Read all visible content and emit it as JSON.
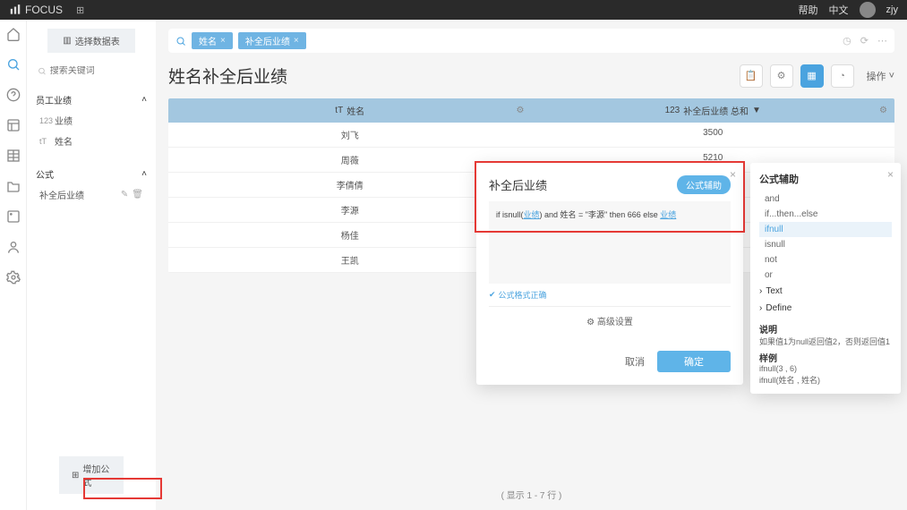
{
  "topbar": {
    "brand": "FOCUS",
    "help": "帮助",
    "lang": "中文",
    "user": "zjy"
  },
  "rail": [
    "home",
    "search",
    "help",
    "dashboard",
    "table",
    "folder",
    "pin",
    "user",
    "settings"
  ],
  "sidebar": {
    "select_btn": "选择数据表",
    "search_ph": "搜索关键词",
    "dataset": "员工业绩",
    "fields": [
      {
        "icon": "123",
        "label": "业绩"
      },
      {
        "icon": "tT",
        "label": "姓名"
      }
    ],
    "formula_head": "公式",
    "formula_item": "补全后业绩",
    "add_formula": "增加公式"
  },
  "search": {
    "chips": [
      "姓名",
      "补全后业绩"
    ]
  },
  "title": "姓名补全后业绩",
  "ops_label": "操作",
  "table": {
    "cols": [
      {
        "icon": "tT",
        "label": "姓名"
      },
      {
        "icon": "123",
        "label": "补全后业绩 总和",
        "sort": true
      }
    ],
    "rows": [
      [
        "刘飞",
        "3500"
      ],
      [
        "周薇",
        "5210"
      ],
      [
        "李倩倩",
        ""
      ],
      [
        "李源",
        ""
      ],
      [
        "杨佳",
        ""
      ],
      [
        "王凯",
        ""
      ]
    ],
    "footer": "( 显示 1 - 7 行 )"
  },
  "modal": {
    "title": "补全后业绩",
    "helper_btn": "公式辅助",
    "formula_pre": "if isnull(",
    "formula_l1": "业绩",
    "formula_mid": ") and 姓名 = \"李源\" then 666 else ",
    "formula_l2": "业绩",
    "valid": "公式格式正确",
    "advanced": "高级设置",
    "cancel": "取消",
    "ok": "确定"
  },
  "helper": {
    "title": "公式辅助",
    "funcs": [
      "and",
      "if...then...else",
      "ifnull",
      "isnull",
      "not",
      "or"
    ],
    "selected": "ifnull",
    "cats": [
      "Text",
      "Define"
    ],
    "desc_h": "说明",
    "desc_t": "如果值1为null返回值2，否则返回值1",
    "ex_h": "样例",
    "ex1": "ifnull(3 , 6)",
    "ex2": "ifnull(姓名 , 姓名)"
  }
}
